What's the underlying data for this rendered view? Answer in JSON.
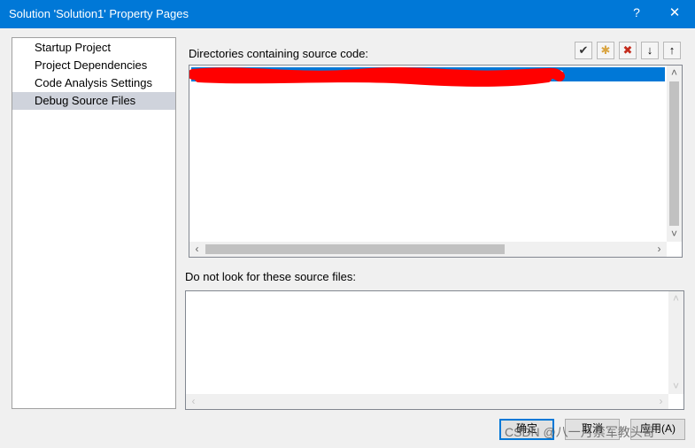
{
  "window": {
    "title": "Solution 'Solution1' Property Pages",
    "help_label": "?",
    "close_label": "✕"
  },
  "nav": {
    "items": [
      {
        "label": "Startup Project",
        "selected": false
      },
      {
        "label": "Project Dependencies",
        "selected": false
      },
      {
        "label": "Code Analysis Settings",
        "selected": false
      },
      {
        "label": "Debug Source Files",
        "selected": true
      }
    ]
  },
  "source_dirs": {
    "label": "Directories containing source code:",
    "rows": [
      {
        "visible_tail": "3",
        "selected": true
      }
    ],
    "toolbar": [
      {
        "name": "checkmark-icon",
        "glyph": "✔"
      },
      {
        "name": "new-folder-icon",
        "glyph": "✱"
      },
      {
        "name": "delete-icon",
        "glyph": "✖"
      },
      {
        "name": "move-down-icon",
        "glyph": "↓"
      },
      {
        "name": "move-up-icon",
        "glyph": "↑"
      }
    ]
  },
  "exclude_files": {
    "label": "Do not look for these source files:"
  },
  "buttons": {
    "ok": "确定",
    "cancel": "取消",
    "apply": "应用(A)"
  },
  "watermark": "CSDN @八一月禁军教头哥",
  "colors": {
    "titlebar": "#0078d7",
    "selection": "#0078d7",
    "nav_selected": "#cfd3dc",
    "redaction": "#ff0000"
  }
}
